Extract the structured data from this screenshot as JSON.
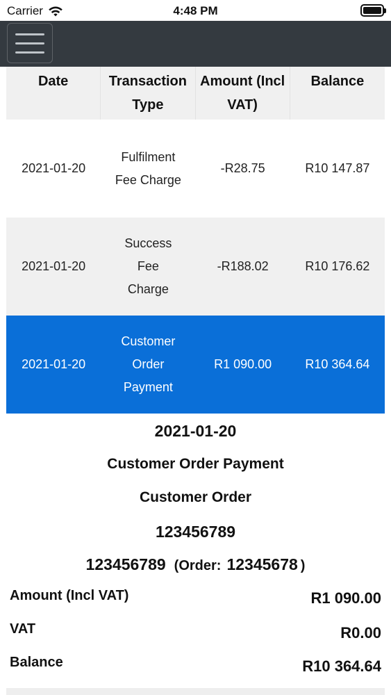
{
  "status_bar": {
    "carrier": "Carrier",
    "time": "4:48 PM",
    "wifi_icon": "wifi-icon",
    "battery_icon": "battery-icon"
  },
  "navbar": {
    "menu_icon": "hamburger-menu-icon",
    "background": "#343a40"
  },
  "table": {
    "headers": {
      "date": "Date",
      "type": "Transaction Type",
      "amount": "Amount (Incl VAT)",
      "balance": "Balance"
    },
    "rows": [
      {
        "date": "2021-01-20",
        "type": "Fulfilment Fee Charge",
        "amount": "-R28.75",
        "balance": "R10 147.87"
      },
      {
        "date": "2021-01-20",
        "type": "Success Fee Charge",
        "amount": "-R188.02",
        "balance": "R10 176.62"
      },
      {
        "date": "2021-01-20",
        "type": "Customer Order Payment",
        "amount": "R1 090.00",
        "balance": "R10 364.64"
      }
    ],
    "selected_color": "#0a6fd8"
  },
  "detail": {
    "date": "2021-01-20",
    "transaction_type": "Customer Order Payment",
    "reference_type": "Customer Order",
    "reference_number": "123456789",
    "reference_number_2": "123456789",
    "order_label": "(Order:",
    "order_number": "12345678",
    "order_close": ")",
    "amount_label": "Amount (Incl VAT)",
    "amount_value": "R1 090.00",
    "vat_label": "VAT",
    "vat_value": "R0.00",
    "balance_label": "Balance",
    "balance_value": "R10 364.64"
  }
}
